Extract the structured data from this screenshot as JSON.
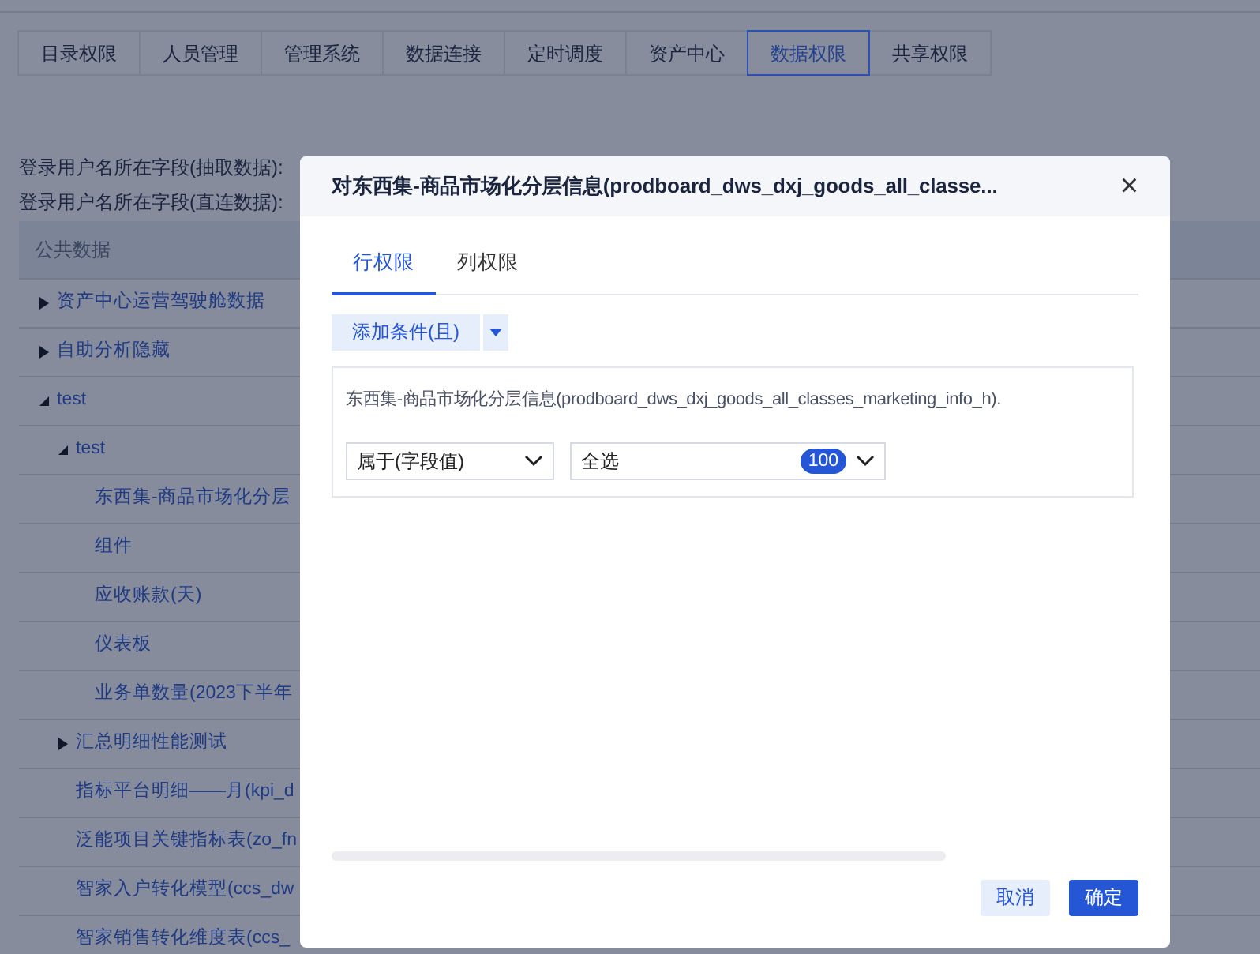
{
  "page_tabs": [
    {
      "label": "目录权限",
      "selected": false
    },
    {
      "label": "人员管理",
      "selected": false
    },
    {
      "label": "管理系统",
      "selected": false
    },
    {
      "label": "数据连接",
      "selected": false
    },
    {
      "label": "定时调度",
      "selected": false
    },
    {
      "label": "资产中心",
      "selected": false
    },
    {
      "label": "数据权限",
      "selected": true
    },
    {
      "label": "共享权限",
      "selected": false
    }
  ],
  "login_fields": [
    "登录用户名所在字段(抽取数据):",
    "登录用户名所在字段(直连数据):"
  ],
  "tree": {
    "header": "公共数据",
    "items": [
      {
        "label": "资产中心运营驾驶舱数据",
        "expanded": false
      },
      {
        "label": "自助分析隐藏",
        "expanded": false
      },
      {
        "label": "test",
        "expanded": true,
        "children": [
          {
            "label": "test",
            "expanded": true,
            "children": [
              {
                "label": "东西集-商品市场化分层"
              },
              {
                "label": "组件"
              },
              {
                "label": "应收账款(天)"
              },
              {
                "label": "仪表板"
              },
              {
                "label": "业务单数量(2023下半年"
              }
            ]
          },
          {
            "label": "汇总明细性能测试",
            "expanded": false
          },
          {
            "label": "指标平台明细——月(kpi_d"
          },
          {
            "label": "泛能项目关键指标表(zo_fn"
          },
          {
            "label": "智家入户转化模型(ccs_dw"
          },
          {
            "label": "智家销售转化维度表(ccs_"
          }
        ]
      }
    ]
  },
  "dialog": {
    "title": "对东西集-商品市场化分层信息(prodboard_dws_dxj_goods_all_classe...",
    "close": "×",
    "tabs": [
      {
        "label": "行权限",
        "selected": true
      },
      {
        "label": "列权限",
        "selected": false
      }
    ],
    "add_button": "添加条件(且)",
    "condition": {
      "field": "东西集-商品市场化分层信息(prodboard_dws_dxj_goods_all_classes_marketing_info_h).",
      "operator": "属于(字段值)",
      "value": "全选",
      "count": "100"
    },
    "buttons": [
      {
        "label": "取消",
        "kind": "secondary"
      },
      {
        "label": "确定",
        "kind": "primary"
      }
    ]
  }
}
